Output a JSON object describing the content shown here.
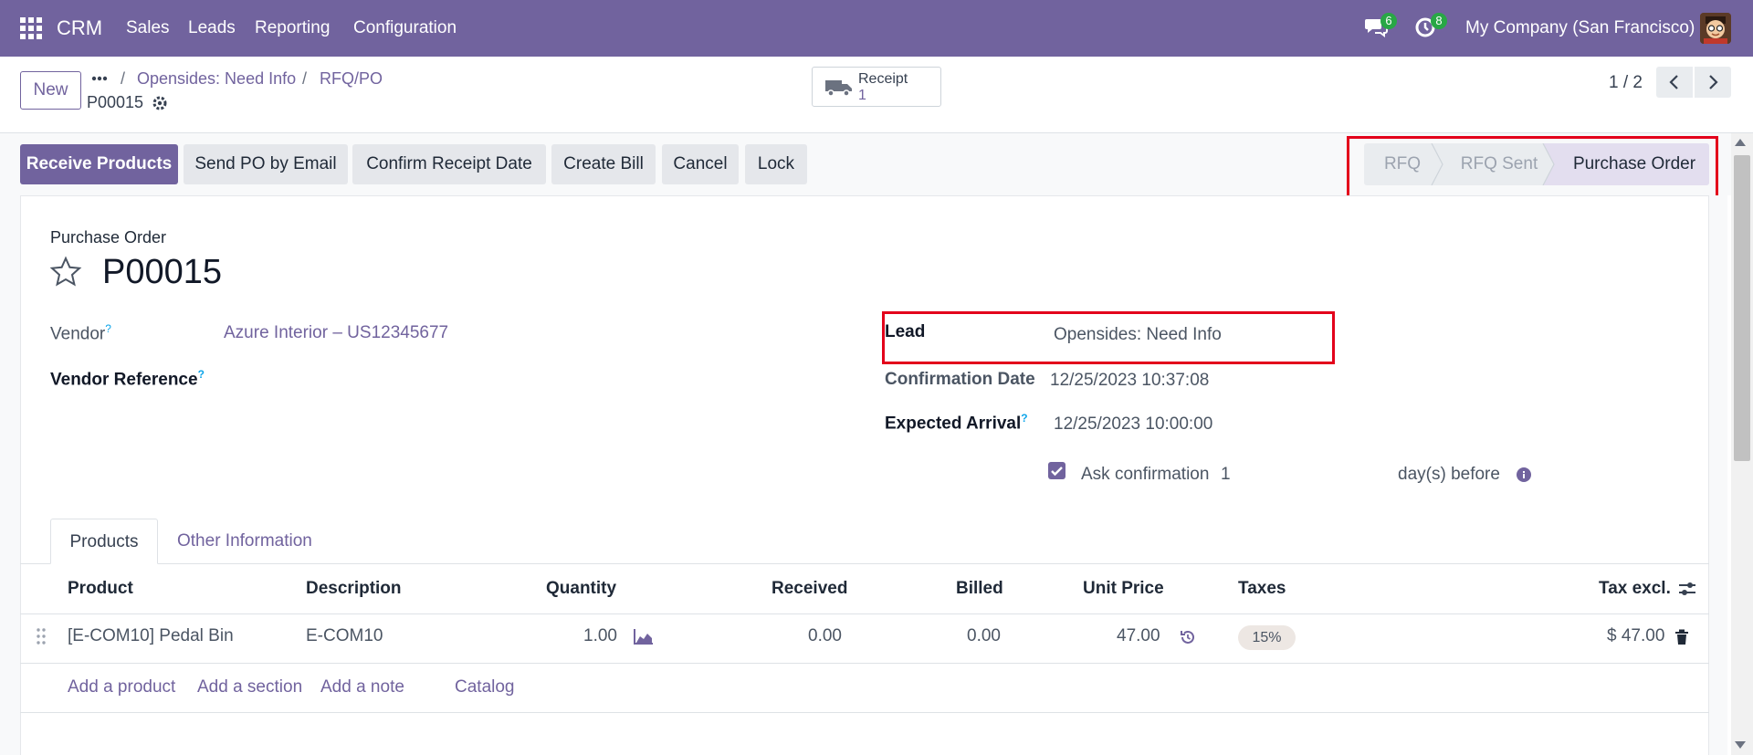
{
  "navbar": {
    "app_name": "CRM",
    "menu": [
      "Sales",
      "Leads",
      "Reporting",
      "Configuration"
    ],
    "messages_count": "6",
    "activities_count": "8",
    "company": "My Company (San Francisco)"
  },
  "control_panel": {
    "new_label": "New",
    "breadcrumb": [
      "Opensides: Need Info",
      "RFQ/PO"
    ],
    "record_name": "P00015",
    "receipt_label": "Receipt",
    "receipt_count": "1",
    "pager": "1 / 2"
  },
  "actions": [
    "Receive Products",
    "Send PO by Email",
    "Confirm Receipt Date",
    "Create Bill",
    "Cancel",
    "Lock"
  ],
  "status": {
    "stages": [
      "RFQ",
      "RFQ Sent",
      "Purchase Order"
    ],
    "active": "Purchase Order"
  },
  "form": {
    "type_label": "Purchase Order",
    "title": "P00015",
    "vendor_label": "Vendor",
    "vendor_value": "Azure Interior – US12345677",
    "vendor_ref_label": "Vendor Reference",
    "lead_label": "Lead",
    "lead_value": "Opensides: Need Info",
    "confirmation_date_label": "Confirmation Date",
    "confirmation_date_value": "12/25/2023 10:37:08",
    "expected_arrival_label": "Expected Arrival",
    "expected_arrival_value": "12/25/2023 10:00:00",
    "ask_confirmation_label": "Ask confirmation",
    "ask_confirmation_checked": true,
    "ask_confirmation_days": "1",
    "days_before_label": "day(s) before",
    "help_mark": "?"
  },
  "tabs": [
    "Products",
    "Other Information"
  ],
  "table": {
    "columns": [
      "Product",
      "Description",
      "Quantity",
      "Received",
      "Billed",
      "Unit Price",
      "Taxes",
      "Tax excl."
    ],
    "rows": [
      {
        "product": "[E-COM10] Pedal Bin",
        "description": "E-COM10",
        "quantity": "1.00",
        "received": "0.00",
        "billed": "0.00",
        "unit_price": "47.00",
        "taxes": "15%",
        "subtotal": "$ 47.00"
      }
    ],
    "add_links": [
      "Add a product",
      "Add a section",
      "Add a note",
      "Catalog"
    ]
  },
  "colors": {
    "brand": "#71639e",
    "highlight_box": "#e3001b",
    "notification_badge": "#28a745"
  }
}
